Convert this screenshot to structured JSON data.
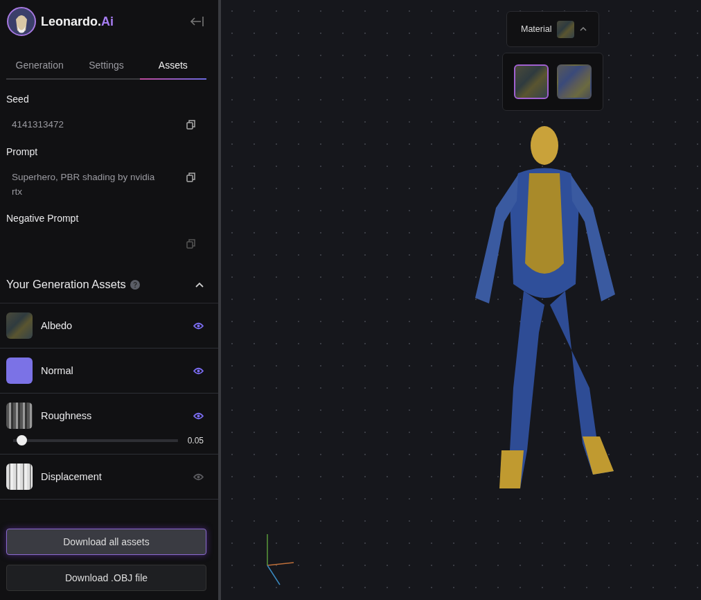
{
  "brand": {
    "name": "Leonardo.",
    "suffix": "Ai"
  },
  "tabs": [
    {
      "label": "Generation",
      "selected": false
    },
    {
      "label": "Settings",
      "selected": false
    },
    {
      "label": "Assets",
      "selected": true
    }
  ],
  "fields": [
    {
      "label": "Seed",
      "value": "4141313472"
    },
    {
      "label": "Prompt",
      "value": "Superhero, PBR shading by nvidia rtx"
    },
    {
      "label": "Negative Prompt"
    }
  ],
  "assets_section": {
    "title": "Your Generation Assets",
    "expanded": true
  },
  "assets": [
    {
      "name": "Albedo",
      "kind": "dark",
      "visible": true
    },
    {
      "name": "Normal",
      "kind": "flat",
      "visible": true
    },
    {
      "name": "Roughness",
      "kind": "grey",
      "visible": true,
      "level": 0.05,
      "reading": "0.05"
    },
    {
      "name": "Displacement",
      "kind": "light",
      "visible": false
    }
  ],
  "buttons": [
    {
      "label": "Download all assets",
      "highlighted": true
    },
    {
      "label": "Download .OBJ file",
      "highlighted": false
    }
  ],
  "material": {
    "label": "Material",
    "expanded": true,
    "options": [
      {
        "kind": "dark",
        "selected": true
      },
      {
        "kind": "blue",
        "selected": false
      }
    ]
  }
}
